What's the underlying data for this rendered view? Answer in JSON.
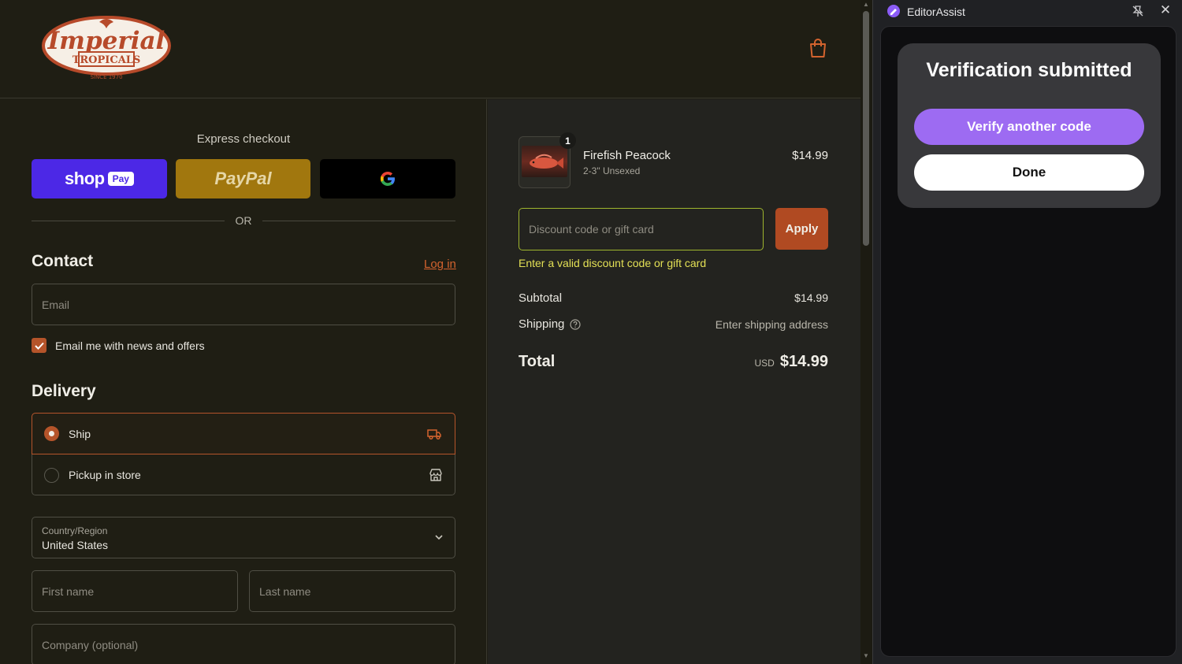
{
  "logo": {
    "main": "Imperial",
    "sub": "TROPICALS",
    "since": "SINCE 1970"
  },
  "express": {
    "title": "Express checkout",
    "shop_word": "shop",
    "shop_pay": "Pay",
    "paypal": "PayPal",
    "google": "G",
    "or": "OR"
  },
  "contact": {
    "title": "Contact",
    "login": "Log in",
    "email_placeholder": "Email",
    "news_label": "Email me with news and offers"
  },
  "delivery": {
    "title": "Delivery",
    "ship": "Ship",
    "pickup": "Pickup in store",
    "country_label": "Country/Region",
    "country_value": "United States",
    "first_name": "First name",
    "last_name": "Last name",
    "company": "Company (optional)"
  },
  "summary": {
    "product_name": "Firefish Peacock",
    "product_variant": "2-3\" Unsexed",
    "product_price": "$14.99",
    "quantity": "1",
    "discount_placeholder": "Discount code or gift card",
    "apply": "Apply",
    "discount_error": "Enter a valid discount code or gift card",
    "subtotal_label": "Subtotal",
    "subtotal_value": "$14.99",
    "shipping_label": "Shipping",
    "shipping_value": "Enter shipping address",
    "total_label": "Total",
    "total_currency": "USD",
    "total_value": "$14.99"
  },
  "assistant": {
    "app_name": "EditorAssist",
    "card_title": "Verification submitted",
    "verify_button": "Verify another code",
    "done_button": "Done"
  },
  "colors": {
    "accent": "#b5542a",
    "apply": "#b04a22",
    "error": "#e3e055",
    "panel_accent": "#9d6bf2",
    "shop": "#4c28e6",
    "paypal": "#a1770e"
  }
}
